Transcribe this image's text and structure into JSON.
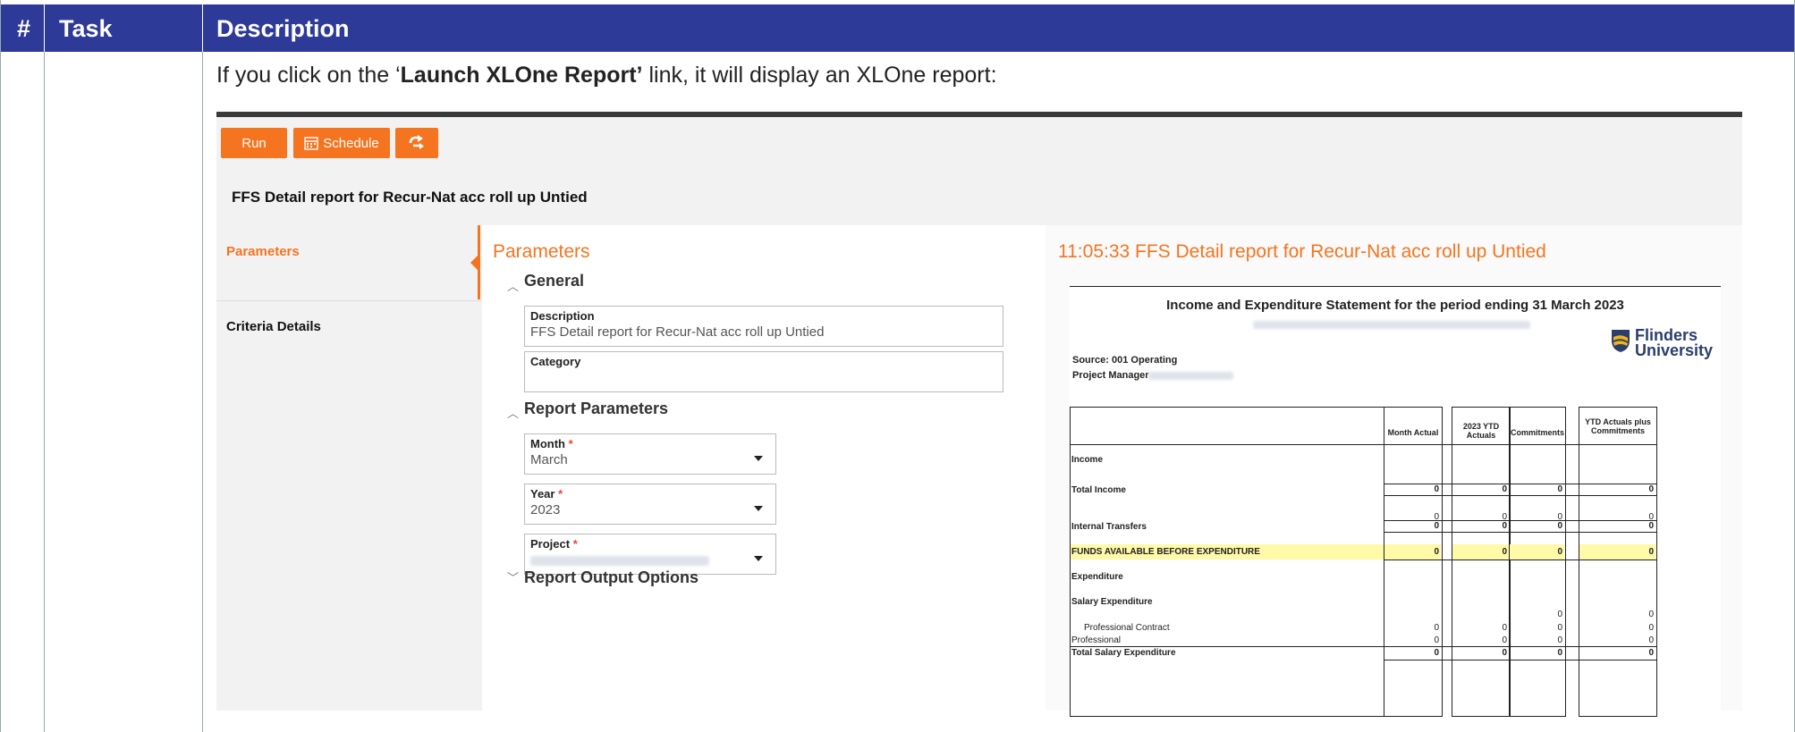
{
  "table_header": {
    "col_num": "#",
    "col_task": "Task",
    "col_desc": "Description"
  },
  "intro": {
    "before": "If you click on the ‘",
    "link": "Launch XLOne Report’",
    "after": " link, it will display an XLOne report:"
  },
  "toolbar": {
    "run": "Run",
    "schedule": "Schedule",
    "export_icon": "export-arrow-icon"
  },
  "report_title": "FFS Detail report for Recur-Nat acc roll up Untied",
  "left_nav": {
    "parameters": "Parameters",
    "criteria": "Criteria Details"
  },
  "params": {
    "heading": "Parameters",
    "general": "General",
    "description_label": "Description",
    "description_value": "FFS Detail report for Recur-Nat acc roll up Untied",
    "category_label": "Category",
    "report_parameters": "Report Parameters",
    "month_label": "Month",
    "month_value": "March",
    "year_label": "Year",
    "year_value": "2023",
    "project_label": "Project",
    "required_mark": "*",
    "report_output": "Report Output Options"
  },
  "preview": {
    "title": "11:05:33 FFS Detail report for Recur-Nat acc roll up Untied",
    "statement_title": "Income and Expenditure Statement for the period ending 31 March 2023",
    "source": "Source: 001 Operating",
    "project_manager": "Project Manager",
    "logo_line1": "Flinders",
    "logo_line2": "University",
    "columns": [
      "Month Actual",
      "2023 YTD Actuals",
      "Commitments",
      "YTD Actuals plus Commitments"
    ],
    "rows": {
      "income": "Income",
      "total_income": "Total Income",
      "internal_transfers": "Internal Transfers",
      "funds_available": "FUNDS AVAILABLE BEFORE EXPENDITURE",
      "expenditure": "Expenditure",
      "salary_expenditure": "Salary Expenditure",
      "professional_contract": "Professional Contract",
      "professional": "Professional",
      "total_salary": "Total Salary Expenditure"
    },
    "zero": "0"
  },
  "colors": {
    "header_bg": "#2e3a97",
    "accent": "#f5741f",
    "highlight": "#fff9a8"
  }
}
